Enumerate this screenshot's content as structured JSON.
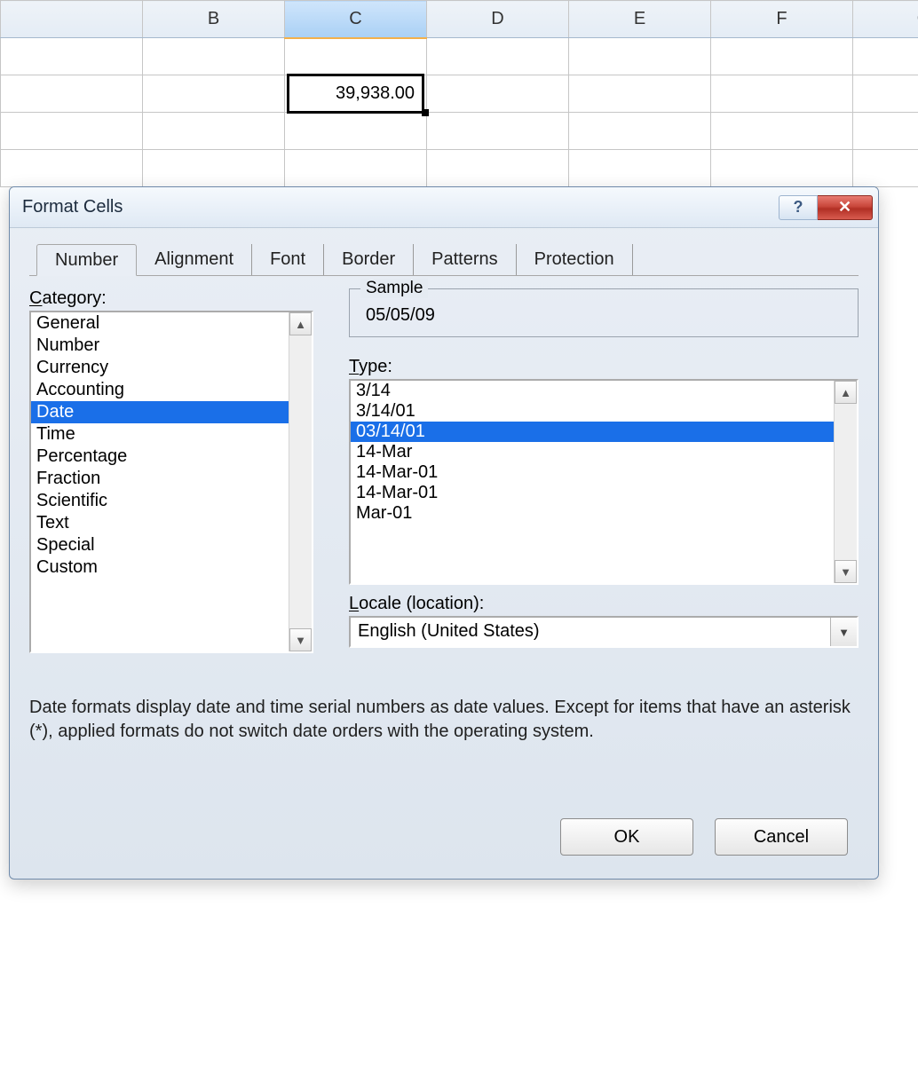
{
  "grid": {
    "columns": [
      "B",
      "C",
      "D",
      "E",
      "F",
      "G"
    ],
    "selected_column_index": 1,
    "cell_value": "39,938.00"
  },
  "dialog": {
    "title": "Format Cells",
    "tabs": [
      "Number",
      "Alignment",
      "Font",
      "Border",
      "Patterns",
      "Protection"
    ],
    "active_tab_index": 0,
    "category_label": "Category:",
    "categories": [
      "General",
      "Number",
      "Currency",
      "Accounting",
      "Date",
      "Time",
      "Percentage",
      "Fraction",
      "Scientific",
      "Text",
      "Special",
      "Custom"
    ],
    "selected_category_index": 4,
    "sample_label": "Sample",
    "sample_value": "05/05/09",
    "type_label": "Type:",
    "types": [
      "3/14",
      "3/14/01",
      "03/14/01",
      "14-Mar",
      "14-Mar-01",
      "14-Mar-01",
      "Mar-01"
    ],
    "selected_type_index": 2,
    "locale_label": "Locale (location):",
    "locale_value": "English (United States)",
    "description": "Date formats display date and time serial numbers as date values. Except for items that have an asterisk (*), applied formats do not switch date orders with the operating system.",
    "ok_label": "OK",
    "cancel_label": "Cancel"
  }
}
